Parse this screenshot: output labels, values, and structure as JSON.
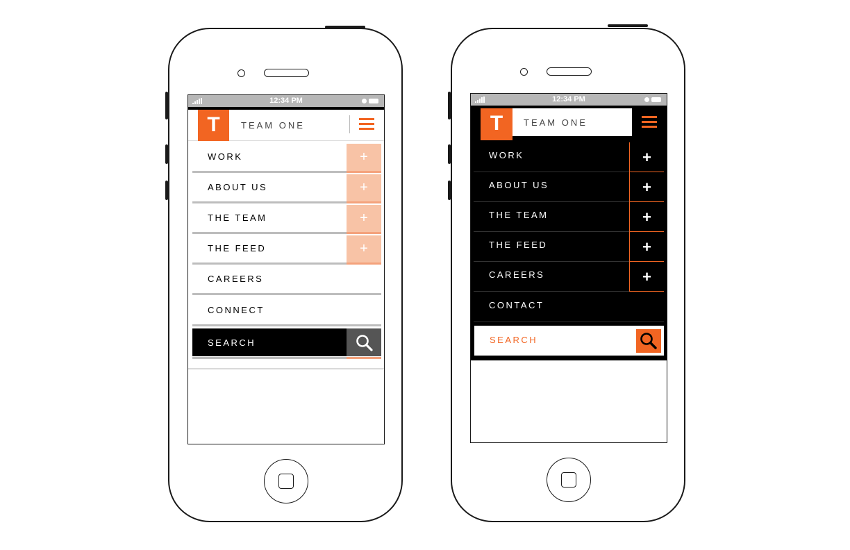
{
  "status_bar": {
    "time": "12:34 PM"
  },
  "brand": {
    "logo_letter": "T",
    "name": "TEAM ONE"
  },
  "left_menu": {
    "items": [
      {
        "label": "WORK",
        "expandable": true
      },
      {
        "label": "ABOUT US",
        "expandable": true
      },
      {
        "label": "THE TEAM",
        "expandable": true
      },
      {
        "label": "THE FEED",
        "expandable": true
      },
      {
        "label": "CAREERS",
        "expandable": false
      },
      {
        "label": "CONNECT",
        "expandable": false
      }
    ],
    "search_label": "SEARCH",
    "plus_symbol": "+"
  },
  "right_menu": {
    "items": [
      {
        "label": "WORK",
        "expandable": true
      },
      {
        "label": "ABOUT US",
        "expandable": true
      },
      {
        "label": "THE TEAM",
        "expandable": true
      },
      {
        "label": "THE FEED",
        "expandable": true
      },
      {
        "label": "CAREERS",
        "expandable": true
      },
      {
        "label": "CONTACT",
        "expandable": false
      }
    ],
    "search_label": "SEARCH",
    "plus_symbol": "+"
  },
  "icons": {
    "menu": "hamburger-icon",
    "search": "magnifier-icon",
    "expand": "plus-icon"
  },
  "colors": {
    "accent": "#f26522",
    "accent_light": "#f8c3a6",
    "dark": "#000000",
    "rule_gray": "#bdbdbd",
    "status_gray": "#b7b7b7"
  }
}
